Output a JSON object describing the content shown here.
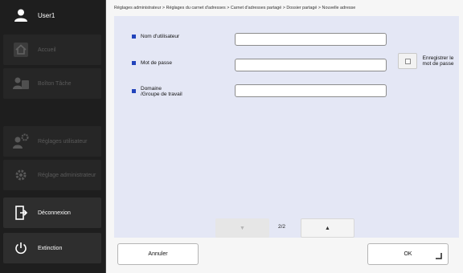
{
  "sidebar": {
    "user_label": "User1",
    "items": [
      {
        "label": "Accueil",
        "icon": "home-icon",
        "enabled": false
      },
      {
        "label": "Boîton Tâche",
        "icon": "job-box-icon",
        "enabled": false
      },
      {
        "label": "Réglages utilisateur",
        "icon": "user-settings-icon",
        "enabled": false
      },
      {
        "label": "Réglage administrateur",
        "icon": "admin-settings-icon",
        "enabled": false
      },
      {
        "label": "Déconnexion",
        "icon": "logout-icon",
        "enabled": true
      },
      {
        "label": "Extinction",
        "icon": "power-icon",
        "enabled": true
      }
    ]
  },
  "breadcrumb": "Réglages administrateur > Réglages du carnet d'adresses > Carnet d'adresses partagé > Dossier partagé > Nouvelle adresse",
  "form": {
    "username_label": "Nom d'utilisateur",
    "username_value": "",
    "password_label": "Mot de passe",
    "password_value": "",
    "domain_label_line1": "Domaine",
    "domain_label_line2": "/Groupe de travail",
    "domain_value": "",
    "save_password_line1": "Enregistrer le",
    "save_password_line2": "mot de passe",
    "save_password_checked": false
  },
  "pager": {
    "page_indicator": "2/2",
    "down_icon": "arrow-down-icon",
    "up_icon": "arrow-up-icon"
  },
  "actions": {
    "cancel_label": "Annuler",
    "ok_label": "OK"
  },
  "colors": {
    "accent": "#2244bb",
    "content_bg": "#e4e7f5",
    "sidebar_bg": "#1e1e1e"
  }
}
